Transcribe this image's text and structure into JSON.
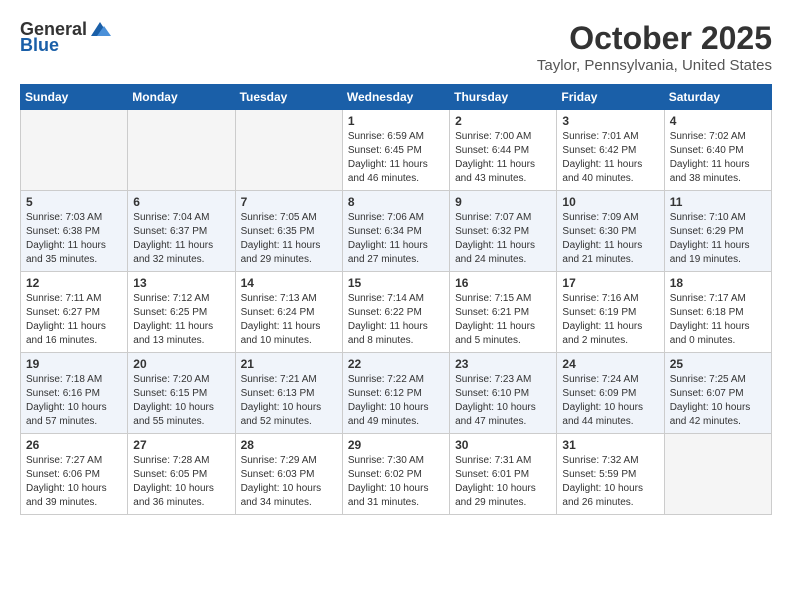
{
  "logo": {
    "general": "General",
    "blue": "Blue"
  },
  "title": "October 2025",
  "location": "Taylor, Pennsylvania, United States",
  "days_of_week": [
    "Sunday",
    "Monday",
    "Tuesday",
    "Wednesday",
    "Thursday",
    "Friday",
    "Saturday"
  ],
  "weeks": [
    [
      {
        "day": "",
        "info": ""
      },
      {
        "day": "",
        "info": ""
      },
      {
        "day": "",
        "info": ""
      },
      {
        "day": "1",
        "info": "Sunrise: 6:59 AM\nSunset: 6:45 PM\nDaylight: 11 hours\nand 46 minutes."
      },
      {
        "day": "2",
        "info": "Sunrise: 7:00 AM\nSunset: 6:44 PM\nDaylight: 11 hours\nand 43 minutes."
      },
      {
        "day": "3",
        "info": "Sunrise: 7:01 AM\nSunset: 6:42 PM\nDaylight: 11 hours\nand 40 minutes."
      },
      {
        "day": "4",
        "info": "Sunrise: 7:02 AM\nSunset: 6:40 PM\nDaylight: 11 hours\nand 38 minutes."
      }
    ],
    [
      {
        "day": "5",
        "info": "Sunrise: 7:03 AM\nSunset: 6:38 PM\nDaylight: 11 hours\nand 35 minutes."
      },
      {
        "day": "6",
        "info": "Sunrise: 7:04 AM\nSunset: 6:37 PM\nDaylight: 11 hours\nand 32 minutes."
      },
      {
        "day": "7",
        "info": "Sunrise: 7:05 AM\nSunset: 6:35 PM\nDaylight: 11 hours\nand 29 minutes."
      },
      {
        "day": "8",
        "info": "Sunrise: 7:06 AM\nSunset: 6:34 PM\nDaylight: 11 hours\nand 27 minutes."
      },
      {
        "day": "9",
        "info": "Sunrise: 7:07 AM\nSunset: 6:32 PM\nDaylight: 11 hours\nand 24 minutes."
      },
      {
        "day": "10",
        "info": "Sunrise: 7:09 AM\nSunset: 6:30 PM\nDaylight: 11 hours\nand 21 minutes."
      },
      {
        "day": "11",
        "info": "Sunrise: 7:10 AM\nSunset: 6:29 PM\nDaylight: 11 hours\nand 19 minutes."
      }
    ],
    [
      {
        "day": "12",
        "info": "Sunrise: 7:11 AM\nSunset: 6:27 PM\nDaylight: 11 hours\nand 16 minutes."
      },
      {
        "day": "13",
        "info": "Sunrise: 7:12 AM\nSunset: 6:25 PM\nDaylight: 11 hours\nand 13 minutes."
      },
      {
        "day": "14",
        "info": "Sunrise: 7:13 AM\nSunset: 6:24 PM\nDaylight: 11 hours\nand 10 minutes."
      },
      {
        "day": "15",
        "info": "Sunrise: 7:14 AM\nSunset: 6:22 PM\nDaylight: 11 hours\nand 8 minutes."
      },
      {
        "day": "16",
        "info": "Sunrise: 7:15 AM\nSunset: 6:21 PM\nDaylight: 11 hours\nand 5 minutes."
      },
      {
        "day": "17",
        "info": "Sunrise: 7:16 AM\nSunset: 6:19 PM\nDaylight: 11 hours\nand 2 minutes."
      },
      {
        "day": "18",
        "info": "Sunrise: 7:17 AM\nSunset: 6:18 PM\nDaylight: 11 hours\nand 0 minutes."
      }
    ],
    [
      {
        "day": "19",
        "info": "Sunrise: 7:18 AM\nSunset: 6:16 PM\nDaylight: 10 hours\nand 57 minutes."
      },
      {
        "day": "20",
        "info": "Sunrise: 7:20 AM\nSunset: 6:15 PM\nDaylight: 10 hours\nand 55 minutes."
      },
      {
        "day": "21",
        "info": "Sunrise: 7:21 AM\nSunset: 6:13 PM\nDaylight: 10 hours\nand 52 minutes."
      },
      {
        "day": "22",
        "info": "Sunrise: 7:22 AM\nSunset: 6:12 PM\nDaylight: 10 hours\nand 49 minutes."
      },
      {
        "day": "23",
        "info": "Sunrise: 7:23 AM\nSunset: 6:10 PM\nDaylight: 10 hours\nand 47 minutes."
      },
      {
        "day": "24",
        "info": "Sunrise: 7:24 AM\nSunset: 6:09 PM\nDaylight: 10 hours\nand 44 minutes."
      },
      {
        "day": "25",
        "info": "Sunrise: 7:25 AM\nSunset: 6:07 PM\nDaylight: 10 hours\nand 42 minutes."
      }
    ],
    [
      {
        "day": "26",
        "info": "Sunrise: 7:27 AM\nSunset: 6:06 PM\nDaylight: 10 hours\nand 39 minutes."
      },
      {
        "day": "27",
        "info": "Sunrise: 7:28 AM\nSunset: 6:05 PM\nDaylight: 10 hours\nand 36 minutes."
      },
      {
        "day": "28",
        "info": "Sunrise: 7:29 AM\nSunset: 6:03 PM\nDaylight: 10 hours\nand 34 minutes."
      },
      {
        "day": "29",
        "info": "Sunrise: 7:30 AM\nSunset: 6:02 PM\nDaylight: 10 hours\nand 31 minutes."
      },
      {
        "day": "30",
        "info": "Sunrise: 7:31 AM\nSunset: 6:01 PM\nDaylight: 10 hours\nand 29 minutes."
      },
      {
        "day": "31",
        "info": "Sunrise: 7:32 AM\nSunset: 5:59 PM\nDaylight: 10 hours\nand 26 minutes."
      },
      {
        "day": "",
        "info": ""
      }
    ]
  ]
}
